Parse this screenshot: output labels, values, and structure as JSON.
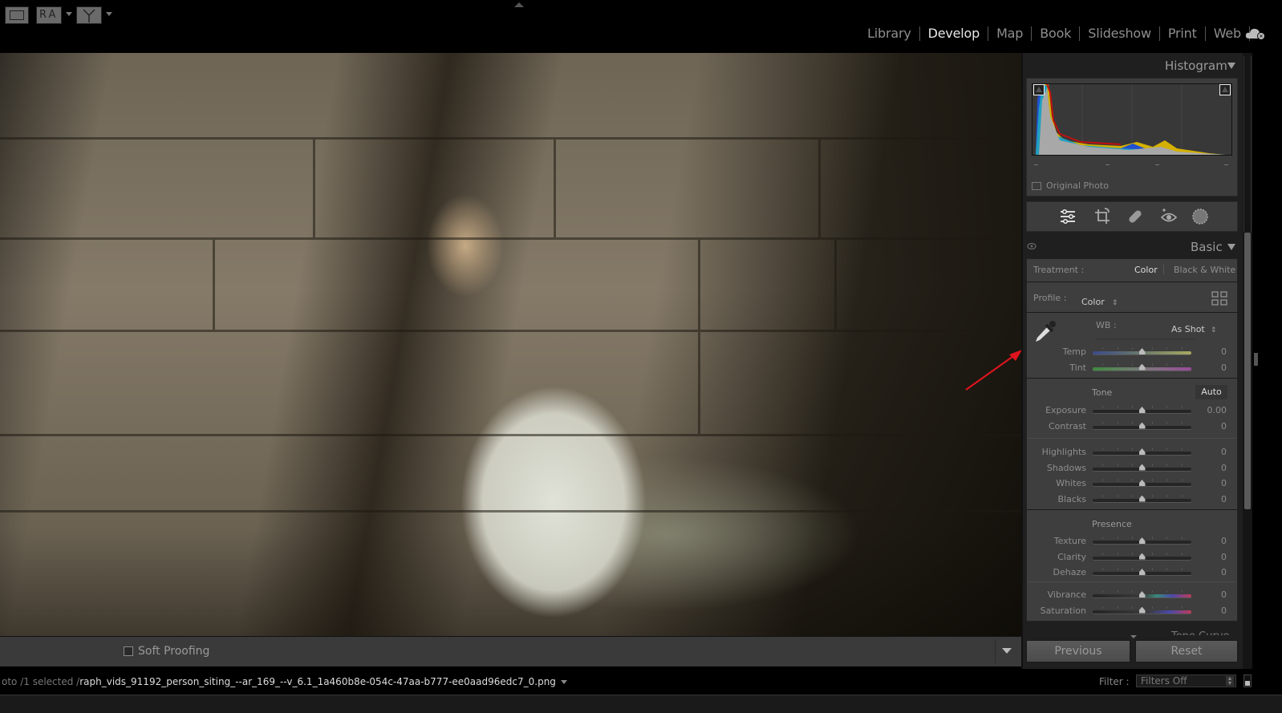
{
  "topbar": {
    "modules": [
      {
        "label": "Library",
        "active": false
      },
      {
        "label": "Develop",
        "active": true
      },
      {
        "label": "Map",
        "active": false
      },
      {
        "label": "Book",
        "active": false
      },
      {
        "label": "Slideshow",
        "active": false
      },
      {
        "label": "Print",
        "active": false
      },
      {
        "label": "Web",
        "active": false
      }
    ],
    "cloud_icon": "cloud-sync-icon"
  },
  "right_panel": {
    "histogram": {
      "title": "Histogram",
      "original_photo_label": "Original Photo"
    },
    "tools": [
      "edit-sliders-icon",
      "crop-icon",
      "healing-icon",
      "red-eye-icon",
      "masking-icon"
    ],
    "basic": {
      "title": "Basic",
      "treatment_label": "Treatment :",
      "treatment_options": [
        "Color",
        "Black & White"
      ],
      "treatment_selected": "Color",
      "profile_label": "Profile :",
      "profile_value": "Color",
      "wb_label": "WB :",
      "wb_value": "As Shot",
      "wb_sliders": [
        {
          "label": "Temp",
          "value": "0",
          "position": 0.5,
          "style": "temp"
        },
        {
          "label": "Tint",
          "value": "0",
          "position": 0.5,
          "style": "tint"
        }
      ],
      "tone_label": "Tone",
      "auto_label": "Auto",
      "tone_sliders_a": [
        {
          "label": "Exposure",
          "value": "0.00",
          "position": 0.5
        },
        {
          "label": "Contrast",
          "value": "0",
          "position": 0.5
        }
      ],
      "tone_sliders_b": [
        {
          "label": "Highlights",
          "value": "0",
          "position": 0.5
        },
        {
          "label": "Shadows",
          "value": "0",
          "position": 0.5
        },
        {
          "label": "Whites",
          "value": "0",
          "position": 0.5
        },
        {
          "label": "Blacks",
          "value": "0",
          "position": 0.5
        }
      ],
      "presence_label": "Presence",
      "presence_sliders_a": [
        {
          "label": "Texture",
          "value": "0",
          "position": 0.5
        },
        {
          "label": "Clarity",
          "value": "0",
          "position": 0.5
        },
        {
          "label": "Dehaze",
          "value": "0",
          "position": 0.5
        }
      ],
      "presence_sliders_b": [
        {
          "label": "Vibrance",
          "value": "0",
          "position": 0.5,
          "style": "vib"
        },
        {
          "label": "Saturation",
          "value": "0",
          "position": 0.5,
          "style": "sat"
        }
      ]
    },
    "next_panel_label": "Tone Curve",
    "previous_label": "Previous",
    "reset_label": "Reset"
  },
  "toolbar": {
    "soft_proofing_label": "Soft Proofing",
    "soft_proofing_checked": false,
    "before_after_label": "RA"
  },
  "statusbar": {
    "path_prefix": "oto  /1 selected  /",
    "filename": "raph_vids_91192_person_siting_--ar_169_--v_6.1_1a460b8e-054c-47aa-b777-ee0aad96edc7_0.png",
    "filter_label": "Filter :",
    "filter_value": "Filters Off"
  },
  "annotation": {
    "highlight_color": "#e0141e",
    "target": "white-balance-selector"
  }
}
